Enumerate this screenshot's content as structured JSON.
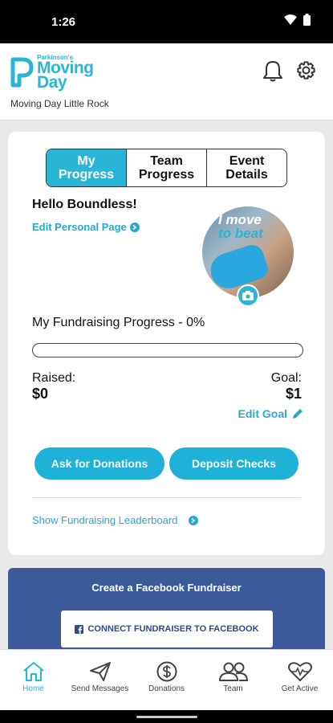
{
  "status": {
    "time": "1:26"
  },
  "header": {
    "logo_small": "Parkinson's",
    "logo_line1": "Moving",
    "logo_line2": "Day",
    "subtitle": "Moving Day Little Rock"
  },
  "tabs": [
    {
      "label": "My Progress",
      "active": true
    },
    {
      "label": "Team Progress",
      "active": false
    },
    {
      "label": "Event Details",
      "active": false
    }
  ],
  "profile": {
    "greeting": "Hello Boundless!",
    "edit_page": "Edit Personal Page",
    "avatar_text1": "I move",
    "avatar_text2": "to beat"
  },
  "fundraising": {
    "title": "My Fundraising Progress - 0%",
    "progress_fraction": 0,
    "raised_label": "Raised:",
    "raised_value": "$0",
    "goal_label": "Goal:",
    "goal_value": "$1",
    "edit_goal": "Edit Goal"
  },
  "actions": {
    "ask": "Ask for Donations",
    "deposit": "Deposit Checks",
    "leaderboard": "Show Fundraising Leaderboard"
  },
  "facebook": {
    "title": "Create a Facebook Fundraiser",
    "button": "CONNECT FUNDRAISER TO FACEBOOK"
  },
  "nav": [
    {
      "label": "Home",
      "icon": "home-icon",
      "active": true
    },
    {
      "label": "Send Messages",
      "icon": "paper-plane-icon",
      "active": false
    },
    {
      "label": "Donations",
      "icon": "dollar-circle-icon",
      "active": false
    },
    {
      "label": "Team",
      "icon": "team-icon",
      "active": false
    },
    {
      "label": "Get Active",
      "icon": "heartbeat-icon",
      "active": false
    }
  ],
  "colors": {
    "accent": "#29b5d6",
    "facebook": "#3a5a99"
  }
}
